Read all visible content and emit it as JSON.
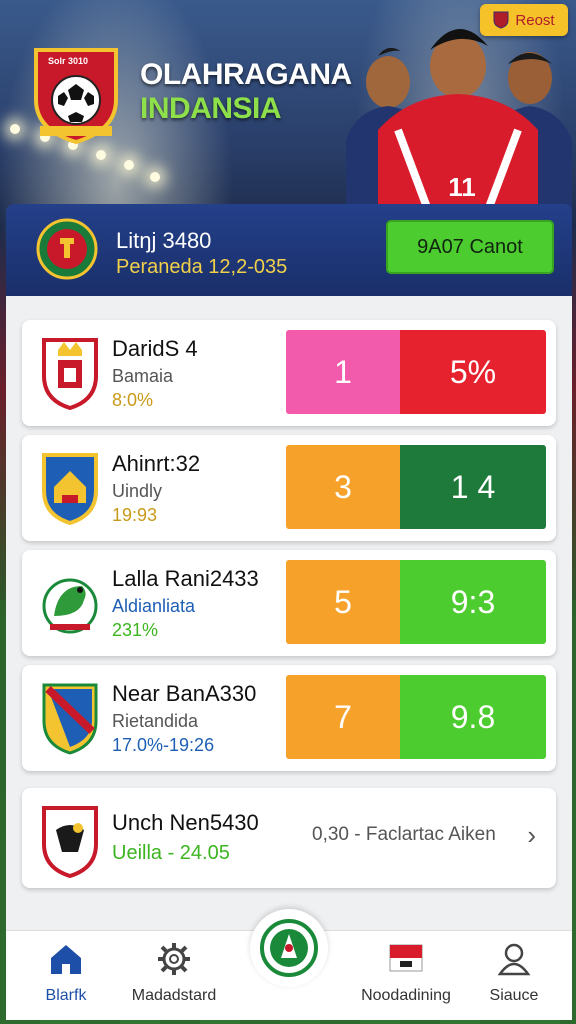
{
  "header": {
    "crest_text": "Solr 3010",
    "title": "OLAHRAGANA",
    "subtitle": "INDANSIA",
    "reset_label": "Reost"
  },
  "info": {
    "line1": "Litŋj 3480",
    "line2": "Peraneda 12,2-035",
    "button_label": "9A07 Canot"
  },
  "matches": [
    {
      "name": "DaridS 4",
      "sub": "Bamaia",
      "pct": "8:0%",
      "pct_color": "#c99a1a",
      "left_score": "1",
      "right_score": "5%",
      "left_color": "#f25bab",
      "right_color": "#e5222d"
    },
    {
      "name": "Ahinrt:32",
      "sub": "Uindly",
      "pct": "19:93",
      "pct_color": "#c99a1a",
      "left_score": "3",
      "right_score": "1 4",
      "left_color": "#f6a12a",
      "right_color": "#1e7a3a"
    },
    {
      "name": "Lalla Rani2433",
      "sub": "Aldianliata",
      "pct": "231%",
      "pct_color": "#3cb521",
      "sub_color": "#1e5fb5",
      "left_score": "5",
      "right_score": "9:3",
      "left_color": "#f6a12a",
      "right_color": "#4ccc2e"
    },
    {
      "name": "Near BanA330",
      "sub": "Rietandida",
      "pct": "17.0%-19:26",
      "pct_color": "#1e5fb5",
      "left_score": "7",
      "right_score": "9.8",
      "left_color": "#f6a12a",
      "right_color": "#4ccc2e"
    }
  ],
  "last_card": {
    "name": "Unch Nen5430",
    "sub": "Ueilla - 24.05",
    "sub_color": "#3cb521",
    "more_text": "0,30  -  Faclartac Aiken"
  },
  "nav": {
    "items": [
      {
        "label": "Blarfk",
        "icon": "home-icon"
      },
      {
        "label": "Madadstard",
        "icon": "gear-icon"
      },
      {
        "label": "Noodadining",
        "icon": "flag-icon"
      },
      {
        "label": "Siauce",
        "icon": "user-icon"
      }
    ],
    "active_color": "#1e4fa8"
  }
}
